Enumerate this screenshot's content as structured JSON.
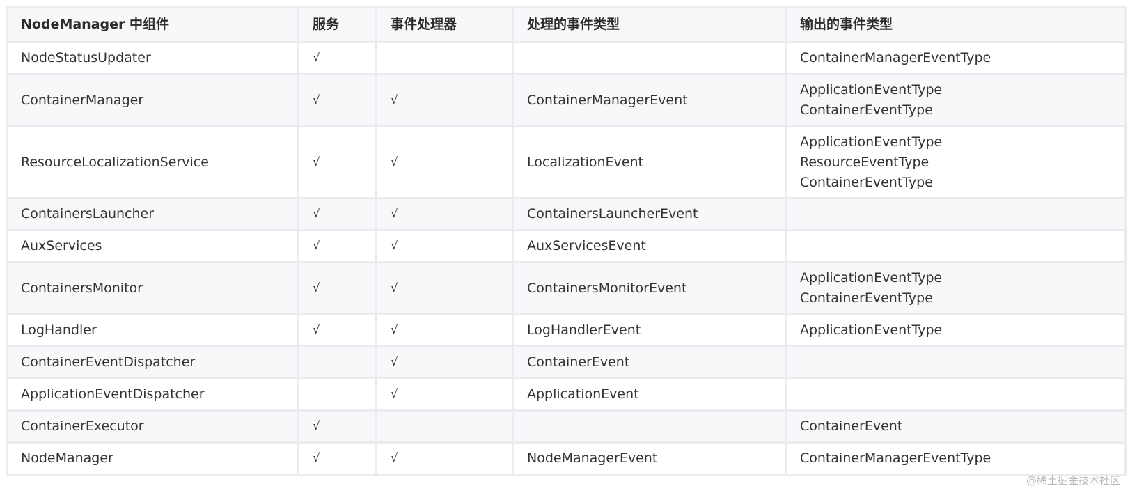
{
  "table": {
    "headers": [
      "NodeManager 中组件",
      "服务",
      "事件处理器",
      "处理的事件类型",
      "输出的事件类型"
    ],
    "rows": [
      {
        "component": "NodeStatusUpdater",
        "service": "√",
        "handler": "",
        "handles": [],
        "outputs": [
          "ContainerManagerEventType"
        ]
      },
      {
        "component": "ContainerManager",
        "service": "√",
        "handler": "√",
        "handles": [
          "ContainerManagerEvent"
        ],
        "outputs": [
          "ApplicationEventType",
          "ContainerEventType"
        ]
      },
      {
        "component": "ResourceLocalizationService",
        "service": "√",
        "handler": "√",
        "handles": [
          "LocalizationEvent"
        ],
        "outputs": [
          "ApplicationEventType",
          "ResourceEventType",
          "ContainerEventType"
        ]
      },
      {
        "component": "ContainersLauncher",
        "service": "√",
        "handler": "√",
        "handles": [
          "ContainersLauncherEvent"
        ],
        "outputs": []
      },
      {
        "component": "AuxServices",
        "service": "√",
        "handler": "√",
        "handles": [
          "AuxServicesEvent"
        ],
        "outputs": []
      },
      {
        "component": "ContainersMonitor",
        "service": "√",
        "handler": "√",
        "handles": [
          "ContainersMonitorEvent"
        ],
        "outputs": [
          "ApplicationEventType",
          "ContainerEventType"
        ]
      },
      {
        "component": "LogHandler",
        "service": "√",
        "handler": "√",
        "handles": [
          "LogHandlerEvent"
        ],
        "outputs": [
          "ApplicationEventType"
        ]
      },
      {
        "component": "ContainerEventDispatcher",
        "service": "",
        "handler": "√",
        "handles": [
          "ContainerEvent"
        ],
        "outputs": []
      },
      {
        "component": "ApplicationEventDispatcher",
        "service": "",
        "handler": "√",
        "handles": [
          "ApplicationEvent"
        ],
        "outputs": []
      },
      {
        "component": "ContainerExecutor",
        "service": "√",
        "handler": "",
        "handles": [],
        "outputs": [
          "ContainerEvent"
        ]
      },
      {
        "component": "NodeManager",
        "service": "√",
        "handler": "√",
        "handles": [
          "NodeManagerEvent"
        ],
        "outputs": [
          "ContainerManagerEventType"
        ]
      }
    ]
  },
  "watermark": "@稀土掘金技术社区"
}
